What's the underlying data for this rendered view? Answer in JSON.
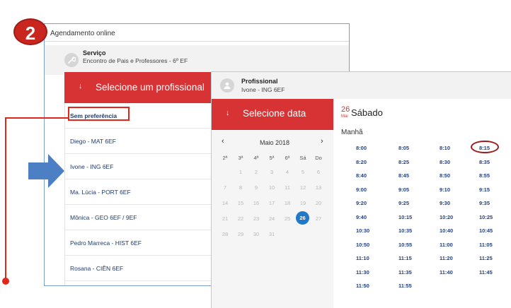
{
  "step_badge": "2",
  "window_title": "Agendamento online",
  "service": {
    "label": "Serviço",
    "value": "Encontro de Pais e Professores - 6º EF"
  },
  "professional_selector": {
    "header": "Selecione um profissional",
    "items": [
      "Sem preferência",
      "Diego - MAT 6EF",
      "Ivone - ING 6EF",
      "Ma. Lúcia - PORT 6EF",
      "Mônica - GEO 6EF / 9EF",
      "Pedro Marreca - HIST 6EF",
      "Rosana - CIÊN 6EF"
    ]
  },
  "selected_professional": {
    "label": "Profissional",
    "value": "Ivone - ING 6EF"
  },
  "date_selector": {
    "header": "Selecione data",
    "month": "Maio 2018",
    "prev": "‹",
    "next": "›",
    "weekdays": [
      "2ª",
      "3ª",
      "4ª",
      "5ª",
      "6ª",
      "Sá",
      "Do"
    ],
    "weeks": [
      [
        "",
        "1",
        "2",
        "3",
        "4",
        "5",
        "6"
      ],
      [
        "7",
        "8",
        "9",
        "10",
        "11",
        "12",
        "13"
      ],
      [
        "14",
        "15",
        "16",
        "17",
        "18",
        "19",
        "20"
      ],
      [
        "21",
        "22",
        "23",
        "24",
        "25",
        "26",
        "27"
      ],
      [
        "28",
        "29",
        "30",
        "31",
        "",
        "",
        ""
      ]
    ],
    "selected_day": "26"
  },
  "day_header": {
    "day_number": "26",
    "month_abbr": "Mai",
    "weekday": "Sábado"
  },
  "period": "Manhã",
  "time_slots": [
    [
      "8:00",
      "8:05",
      "8:10",
      "8:15"
    ],
    [
      "8:20",
      "8:25",
      "8:30",
      "8:35"
    ],
    [
      "8:40",
      "8:45",
      "8:50",
      "8:55"
    ],
    [
      "9:00",
      "9:05",
      "9:10",
      "9:15"
    ],
    [
      "9:20",
      "9:25",
      "9:30",
      "9:35"
    ],
    [
      "9:40",
      "10:15",
      "10:20",
      "10:25"
    ],
    [
      "10:30",
      "10:35",
      "10:40",
      "10:45"
    ],
    [
      "10:50",
      "10:55",
      "11:00",
      "11:05"
    ],
    [
      "11:10",
      "11:15",
      "11:20",
      "11:25"
    ],
    [
      "11:30",
      "11:35",
      "11:40",
      "11:45"
    ],
    [
      "11:50",
      "11:55",
      "",
      ""
    ]
  ],
  "colors": {
    "header_red": "#d73335",
    "link_blue": "#233f80",
    "selected_blue": "#1f78c8",
    "annotation_red": "#e1261c",
    "pointer_blue": "#4d7fc4"
  },
  "icons": [
    "wrench-icon",
    "person-icon",
    "arrow-down-icon",
    "chevron-left-icon",
    "chevron-right-icon",
    "block-arrow-right-icon"
  ]
}
